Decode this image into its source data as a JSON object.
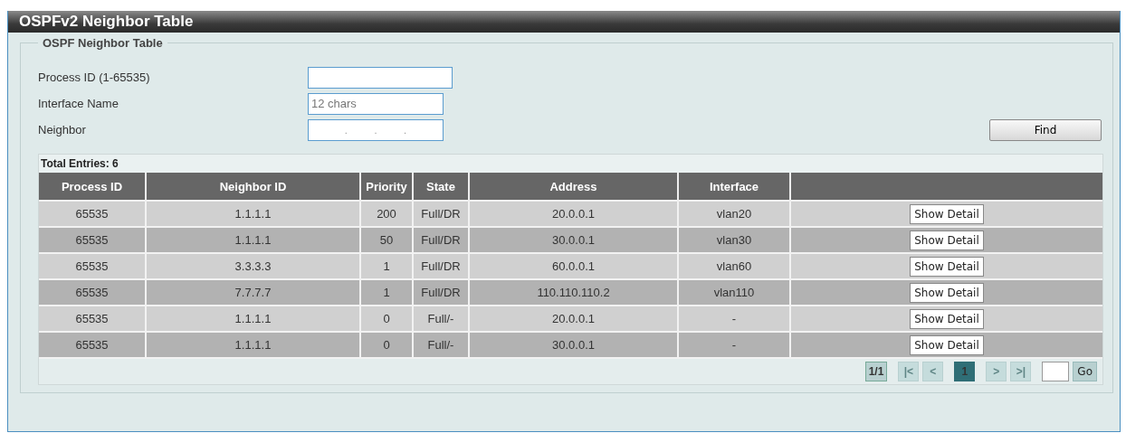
{
  "window": {
    "title": "OSPFv2 Neighbor Table"
  },
  "section": {
    "legend": "OSPF Neighbor Table",
    "fields": [
      {
        "kind": "text",
        "label": "Process ID (1-65535)"
      },
      {
        "kind": "text",
        "label": "Interface Name",
        "placeholder": "12 chars"
      },
      {
        "kind": "ip",
        "label": "Neighbor",
        "separators": [
          ".",
          ".",
          "."
        ]
      }
    ],
    "find_button": "Find"
  },
  "table": {
    "total": "Total Entries: 6",
    "columns": [
      "Process ID",
      "Neighbor ID",
      "Priority",
      "State",
      "Address",
      "Interface"
    ],
    "rows": [
      {
        "cells": [
          "65535",
          "1.1.1.1",
          "200",
          "Full/DR",
          "20.0.0.1",
          "vlan20"
        ],
        "action": "Show Detail"
      },
      {
        "cells": [
          "65535",
          "1.1.1.1",
          "50",
          "Full/DR",
          "30.0.0.1",
          "vlan30"
        ],
        "action": "Show Detail"
      },
      {
        "cells": [
          "65535",
          "3.3.3.3",
          "1",
          "Full/DR",
          "60.0.0.1",
          "vlan60"
        ],
        "action": "Show Detail"
      },
      {
        "cells": [
          "65535",
          "7.7.7.7",
          "1",
          "Full/DR",
          "110.110.110.2",
          "vlan110"
        ],
        "action": "Show Detail"
      },
      {
        "cells": [
          "65535",
          "1.1.1.1",
          "0",
          "Full/-",
          "20.0.0.1",
          "-"
        ],
        "action": "Show Detail"
      },
      {
        "cells": [
          "65535",
          "1.1.1.1",
          "0",
          "Full/-",
          "30.0.0.1",
          "-"
        ],
        "action": "Show Detail"
      }
    ]
  },
  "pager": {
    "count": "1/1",
    "buttons": [
      {
        "label": "|<",
        "disabled": true,
        "selected": false
      },
      {
        "label": "<",
        "disabled": true,
        "selected": false
      },
      {
        "label": "1",
        "disabled": false,
        "selected": true
      },
      {
        "label": ">",
        "disabled": true,
        "selected": false
      },
      {
        "label": ">|",
        "disabled": true,
        "selected": false
      }
    ],
    "go": "Go"
  }
}
